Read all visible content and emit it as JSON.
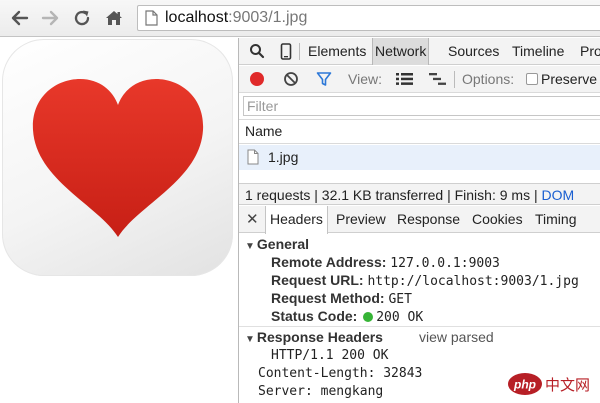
{
  "browser": {
    "url_host": "localhost",
    "url_rest": ":9003/1.jpg",
    "icons": [
      "back-arrow-icon",
      "forward-arrow-icon",
      "reload-icon",
      "home-icon",
      "page-icon"
    ]
  },
  "devtools": {
    "tabs": [
      "Elements",
      "Network",
      "Sources",
      "Timeline",
      "Pro"
    ],
    "active_tab": "Network",
    "network_toolbar": {
      "view_label": "View:",
      "options_label": "Options:",
      "preserve_label": "Preserve"
    },
    "filter_placeholder": "Filter",
    "column_name": "Name",
    "file": "1.jpg",
    "summary": {
      "main": "1 requests  |  32.1 KB transferred  |  Finish: 9 ms  |  ",
      "dom": "DOM"
    },
    "detail_tabs": [
      "Headers",
      "Preview",
      "Response",
      "Cookies",
      "Timing"
    ],
    "active_detail_tab": "Headers",
    "general": {
      "title": "General",
      "remote_address_key": "Remote Address:",
      "remote_address_val": "127.0.0.1:9003",
      "request_url_key": "Request URL:",
      "request_url_val": "http://localhost:9003/1.jpg",
      "request_method_key": "Request Method:",
      "request_method_val": "GET",
      "status_code_key": "Status Code:",
      "status_code_val": "200 OK"
    },
    "response_headers": {
      "title": "Response Headers",
      "view_parsed": "view parsed",
      "status_line": "HTTP/1.1 200 OK",
      "content_length": "Content-Length: 32843",
      "server": "Server: mengkang"
    }
  },
  "watermark": "php 中文网",
  "colors": {
    "heart": "#d8261c",
    "record": "#e02a2a",
    "status_ok": "#36b436",
    "link_blue": "#1a5fd1"
  }
}
